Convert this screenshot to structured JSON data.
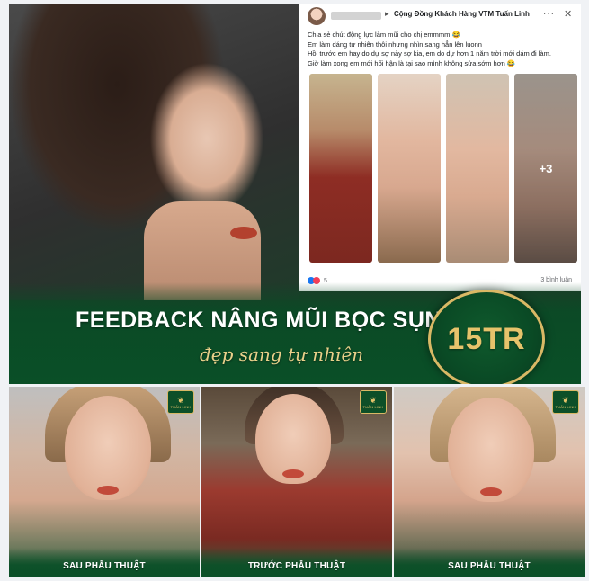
{
  "post": {
    "group_name": "Cộng Đồng Khách Hàng VTM Tuấn Linh",
    "more_icon": "more-horizontal-icon",
    "close_icon": "close-icon",
    "lines": [
      "Chia sẻ chút động lực làm mũi cho chị emmmm 😂",
      "Em làm dáng tự nhiên thôi nhưng nhìn sang hẳn lên luonn",
      "Hồi trước em hay do dự sợ này sợ kia, em do dự hơn 1 năm trời mới dám đi làm.",
      "Giờ làm xong em mới hối hận là tại sao mình không sửa sớm hơn 😂"
    ],
    "more_photos": "+3",
    "reaction_count": "5",
    "comments": "3 bình luận"
  },
  "banner": {
    "headline": "FEEDBACK NÂNG MŨI BỌC SỤN",
    "subline": "đẹp sang tự nhiên",
    "price": "15TR"
  },
  "tiles": [
    {
      "caption": "SAU PHẪU THUẬT",
      "logo": "TUẤN LINH"
    },
    {
      "caption": "TRƯỚC PHẪU THUẬT",
      "logo": "TUẤN LINH"
    },
    {
      "caption": "SAU PHẪU THUẬT",
      "logo": "TUẤN LINH"
    }
  ],
  "colors": {
    "brand_green": "#0b5028",
    "gold": "#e6c36b",
    "facebook_blue": "#1877f2"
  }
}
